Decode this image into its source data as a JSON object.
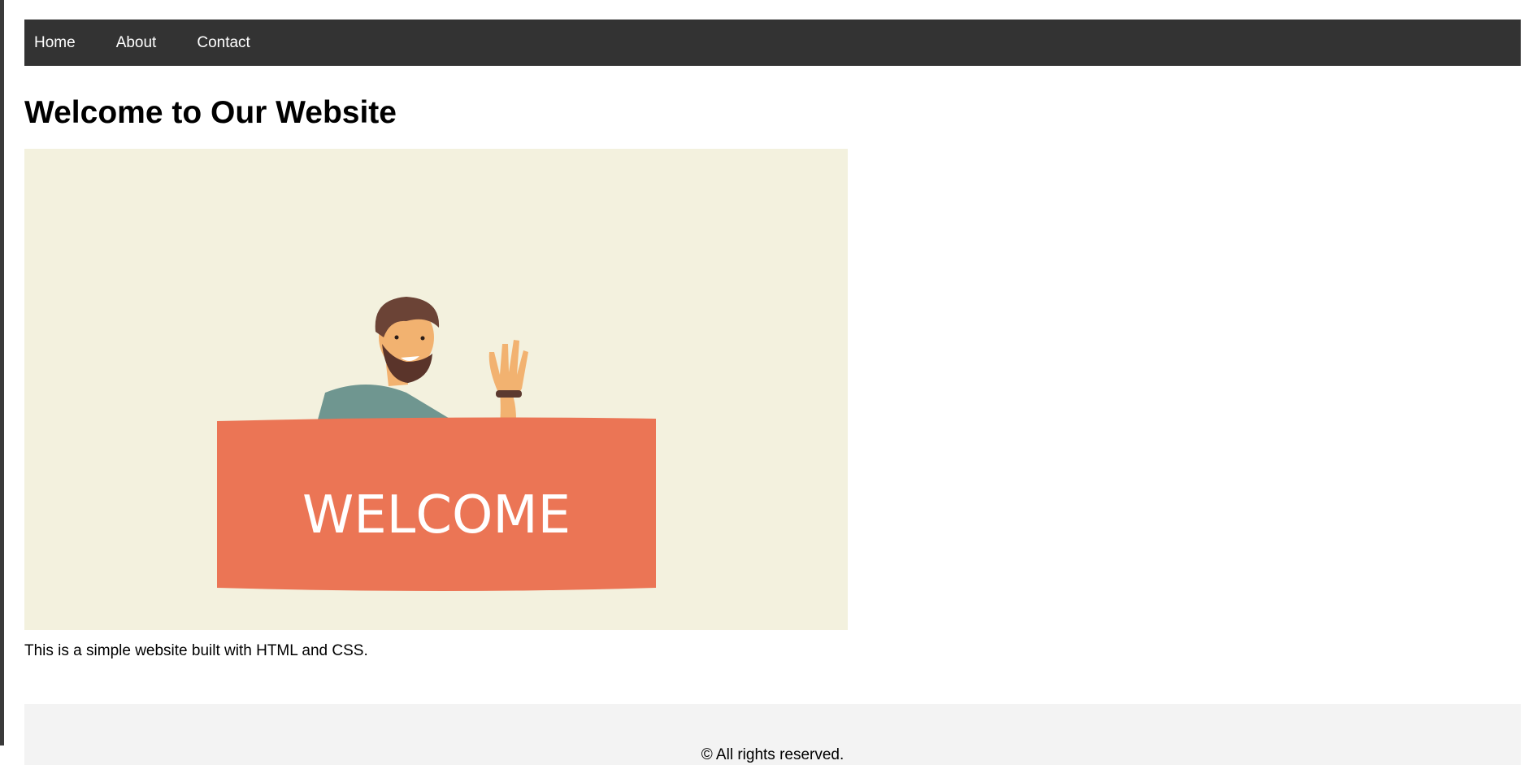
{
  "nav": {
    "items": [
      {
        "label": "Home"
      },
      {
        "label": "About"
      },
      {
        "label": "Contact"
      }
    ]
  },
  "main": {
    "title": "Welcome to Our Website",
    "hero_sign_text": "WELCOME",
    "description": "This is a simple website built with HTML and CSS."
  },
  "footer": {
    "text": "© All rights reserved."
  },
  "colors": {
    "nav_bg": "#333333",
    "hero_bg": "#f3f1de",
    "sign": "#eb7555",
    "shirt": "#6f9690",
    "skin": "#f2b270",
    "hair": "#6b4336",
    "footer_bg": "#f3f3f3"
  }
}
